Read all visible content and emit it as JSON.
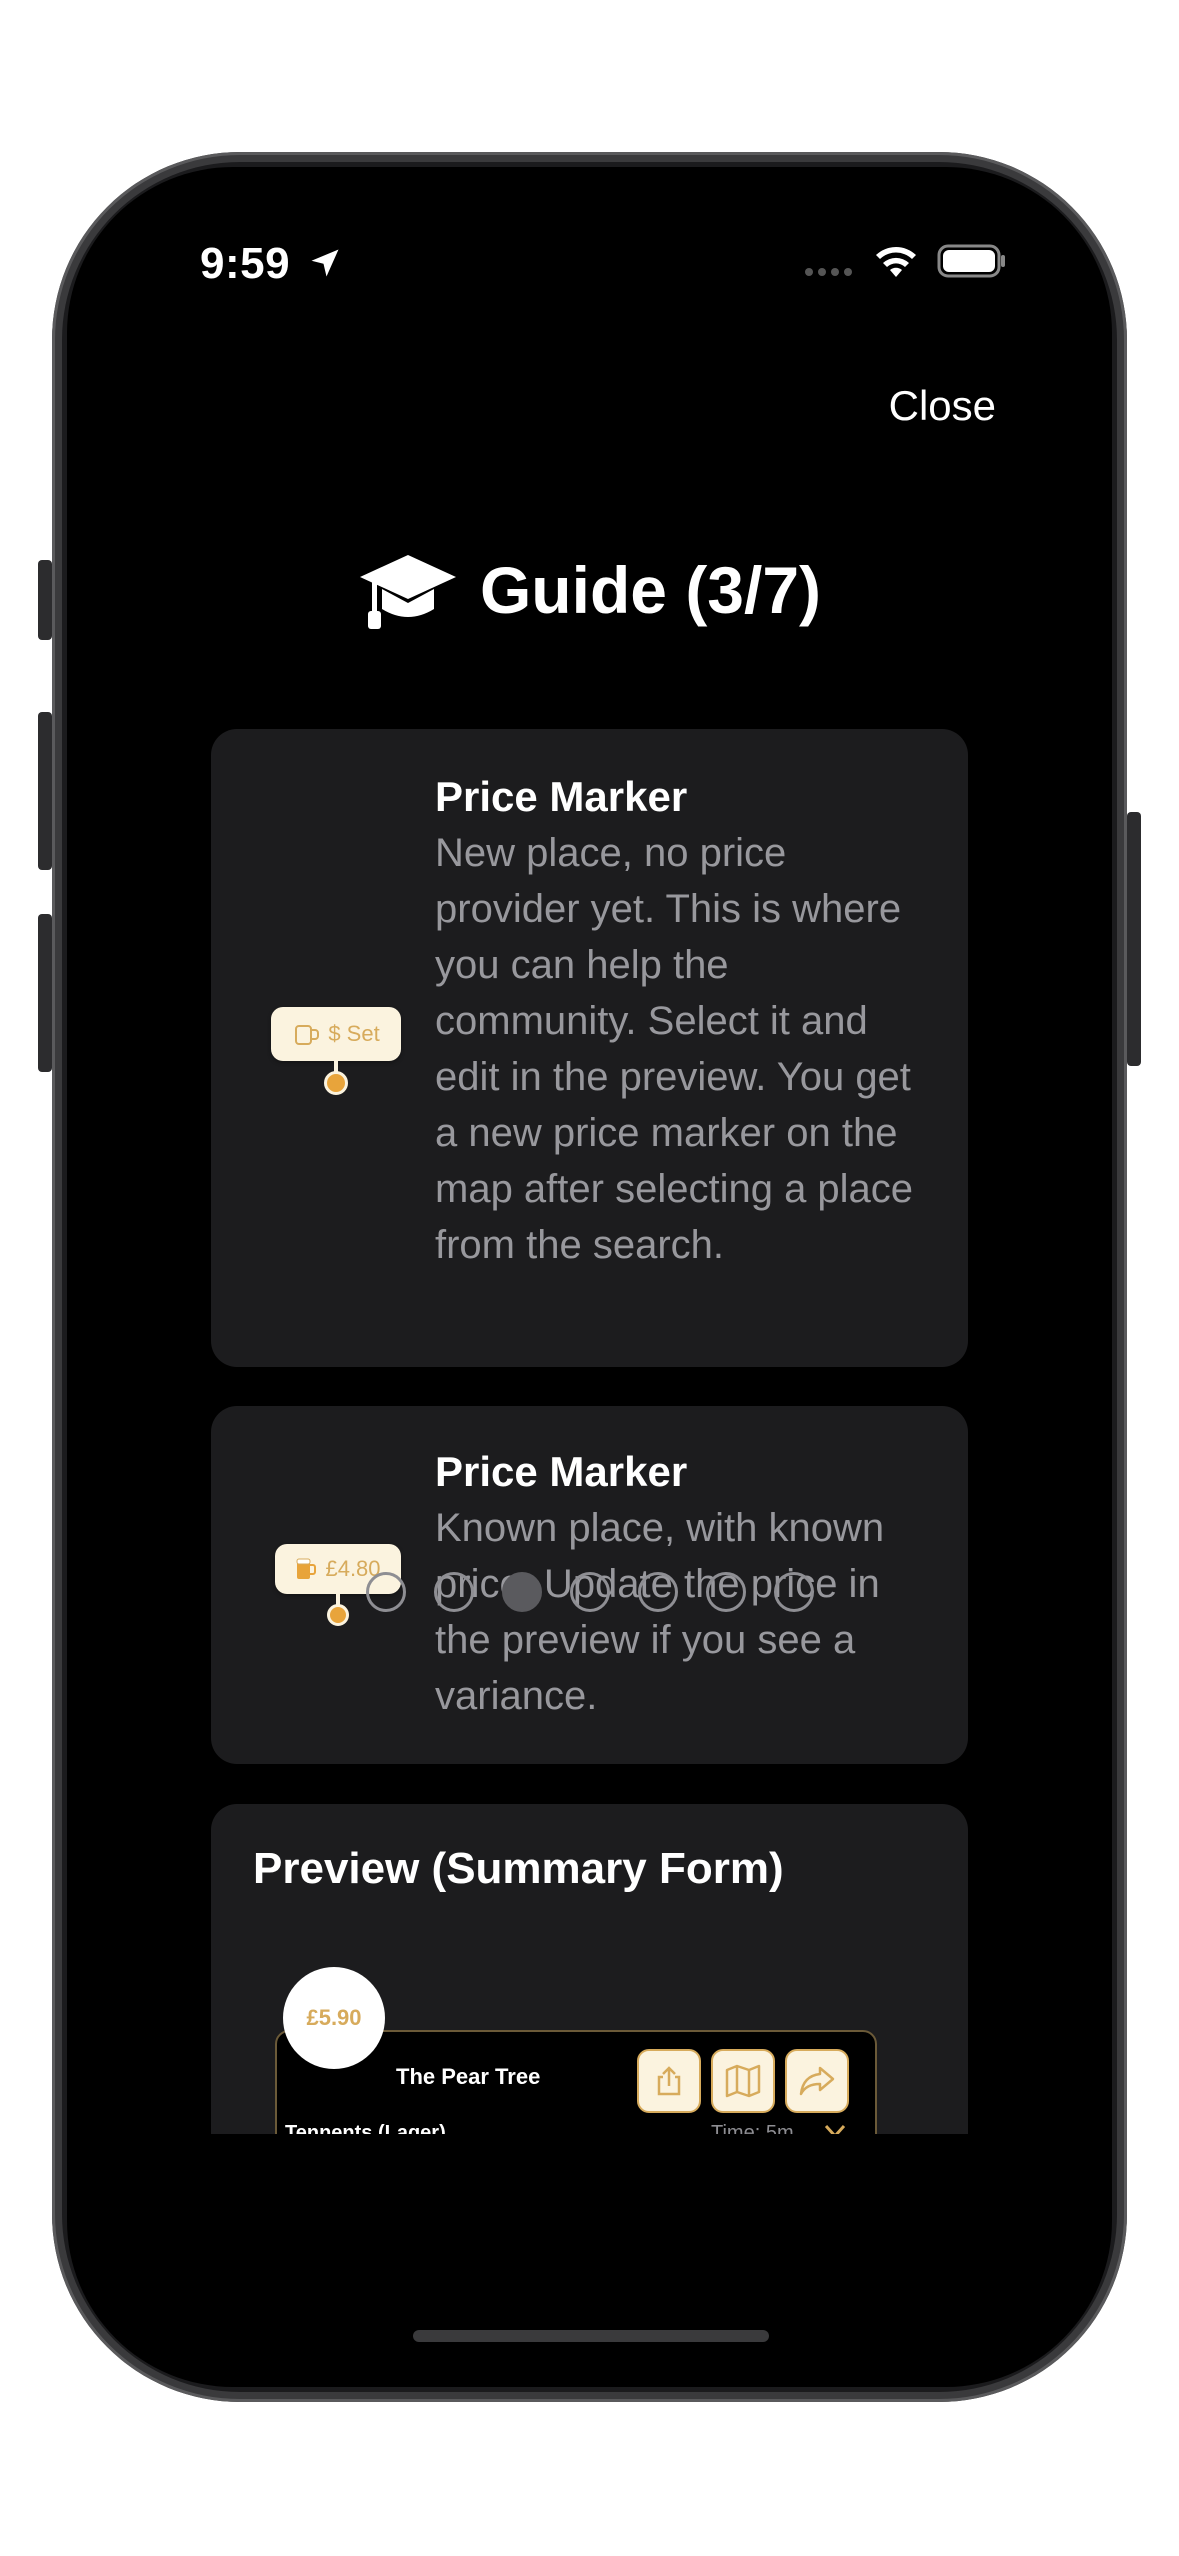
{
  "status_bar": {
    "time": "9:59"
  },
  "header": {
    "close_label": "Close",
    "title": "Guide (3/7)"
  },
  "cards": [
    {
      "marker_label": "$ Set",
      "title": "Price Marker",
      "text": "New place, no price provider yet. This is where you can help the community. Select it and edit in the preview. You get a new price marker on the map after selecting a place from the search."
    },
    {
      "marker_label": "£4.80",
      "title": "Price Marker",
      "text": "Known place, with known price. Update the price in the preview if you see a variance."
    },
    {
      "title": "Preview (Summary Form)",
      "preview": {
        "price": "£5.90",
        "place_name": "The Pear Tree",
        "drink": "Tennents (Lager)",
        "time": "Time: 5m"
      }
    }
  ],
  "pager": {
    "count": 7,
    "current": 3
  },
  "colors": {
    "accent": "#d7ab5c",
    "marker_bg": "#fbf3df",
    "card_bg": "#1c1c1e",
    "secondary_text": "#98989d"
  }
}
